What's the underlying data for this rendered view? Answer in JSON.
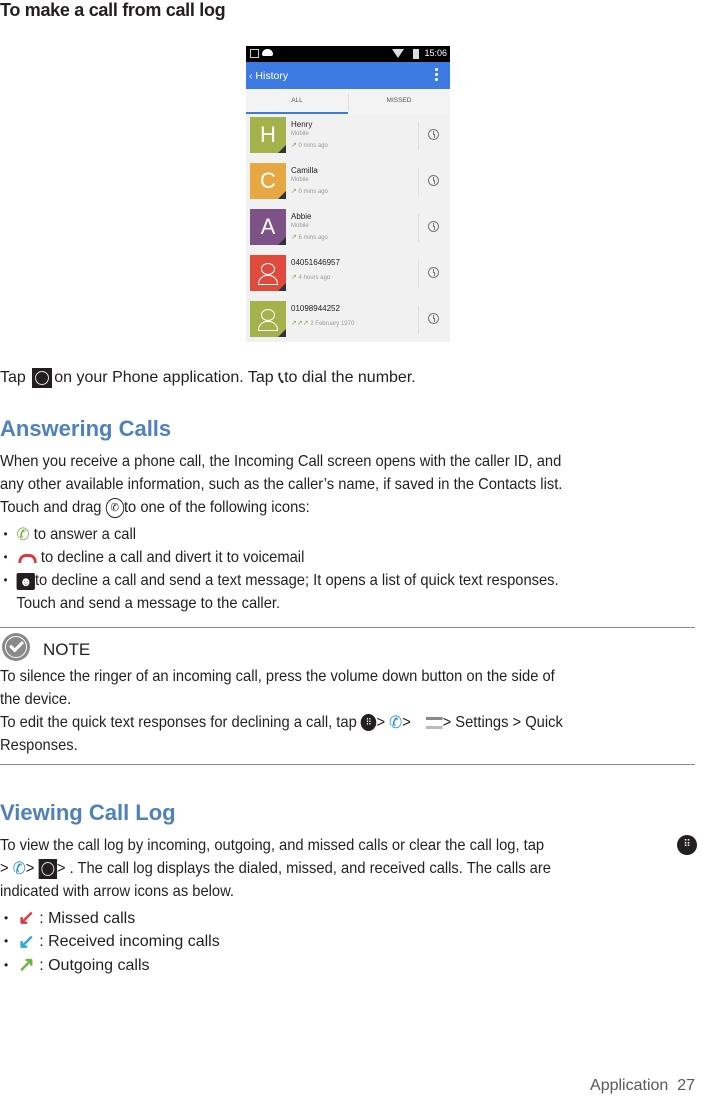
{
  "heading_make_call": "To make a call from call  log",
  "phone": {
    "status_time": "15:06",
    "appbar_title": "‹ History",
    "tabs": [
      {
        "label": "ALL",
        "selected": true
      },
      {
        "label": "MISSED",
        "selected": false
      }
    ],
    "entries": [
      {
        "avatar_letter": "H",
        "avatar_color": "#a3b24a",
        "name": "Henry",
        "type": "Mobile",
        "arrows": "↗",
        "time": "0 mins ago"
      },
      {
        "avatar_letter": "C",
        "avatar_color": "#e7a843",
        "name": "Camilla",
        "type": "Mobile",
        "arrows": "↗",
        "time": "0 mins ago"
      },
      {
        "avatar_letter": "A",
        "avatar_color": "#7d5387",
        "name": "Abbie",
        "type": "Mobile",
        "arrows": "↗",
        "time": "6 mins ago"
      },
      {
        "avatar_letter": "",
        "avatar_color": "#de4b3c",
        "name": "04051646957",
        "type": "",
        "arrows": "↗",
        "time": "4 hours ago"
      },
      {
        "avatar_letter": "",
        "avatar_color": "#a3b24a",
        "name": "01098944252",
        "type": "",
        "arrows": "↗↗↗",
        "time": "2 February 1970"
      }
    ]
  },
  "tap_line": {
    "part1": "Tap ",
    "part2": "on your Phone application. Tap ",
    "part3": "to dial the  number."
  },
  "answering": {
    "heading": "Answering Calls",
    "para_line1": "When you receive a phone call, the Incoming Call screen opens with the caller ID, and",
    "para_line2": "any other available information, such as the caller’s name, if saved in the Contacts list.",
    "para_line3a": "Touch and drag ",
    "para_line3b": "to one of the following   icons:",
    "bullets": [
      {
        "icon": "green-phone-icon",
        "text": " to answer a  call"
      },
      {
        "icon": "red-hangup-icon",
        "text": " to decline a call and divert it to  voicemail"
      },
      {
        "icon": "message-smiley-icon",
        "text": "to decline a call and send a text message; It opens a list of quick text responses."
      }
    ],
    "bullet3_cont": "Touch and send a message to the  caller."
  },
  "note": {
    "label": "NOTE",
    "line1": "To  silence the ringer of an incoming call, press the volume down button on the side of",
    "line2": "the device.",
    "line3a": "To edit the quick text responses for declining a call, tap ",
    "sep1": "> ",
    "sep2": "> ",
    "line3b": "> Settings > Quick",
    "line4": "Responses."
  },
  "viewing": {
    "heading": "Viewing Call Log",
    "line1": "To  view the call log by incoming, outgoing, and missed calls or clear the call log, tap",
    "line2a": "> ",
    "line2b": "> ",
    "line2c": "> . The call log displays the dialed, missed, and received calls. The calls are",
    "line3": "indicated with arrow icons as  below.",
    "legend": [
      {
        "icon": "missed-arrow-icon",
        "color": "#e0383e",
        "text": " : Missed calls"
      },
      {
        "icon": "received-arrow-icon",
        "color": "#27a9e1",
        "text": " : Received incoming calls"
      },
      {
        "icon": "outgoing-arrow-icon",
        "color": "#6cb33e",
        "text": " : Outgoing calls"
      }
    ]
  },
  "footer": {
    "section": "Application",
    "page": "27"
  }
}
